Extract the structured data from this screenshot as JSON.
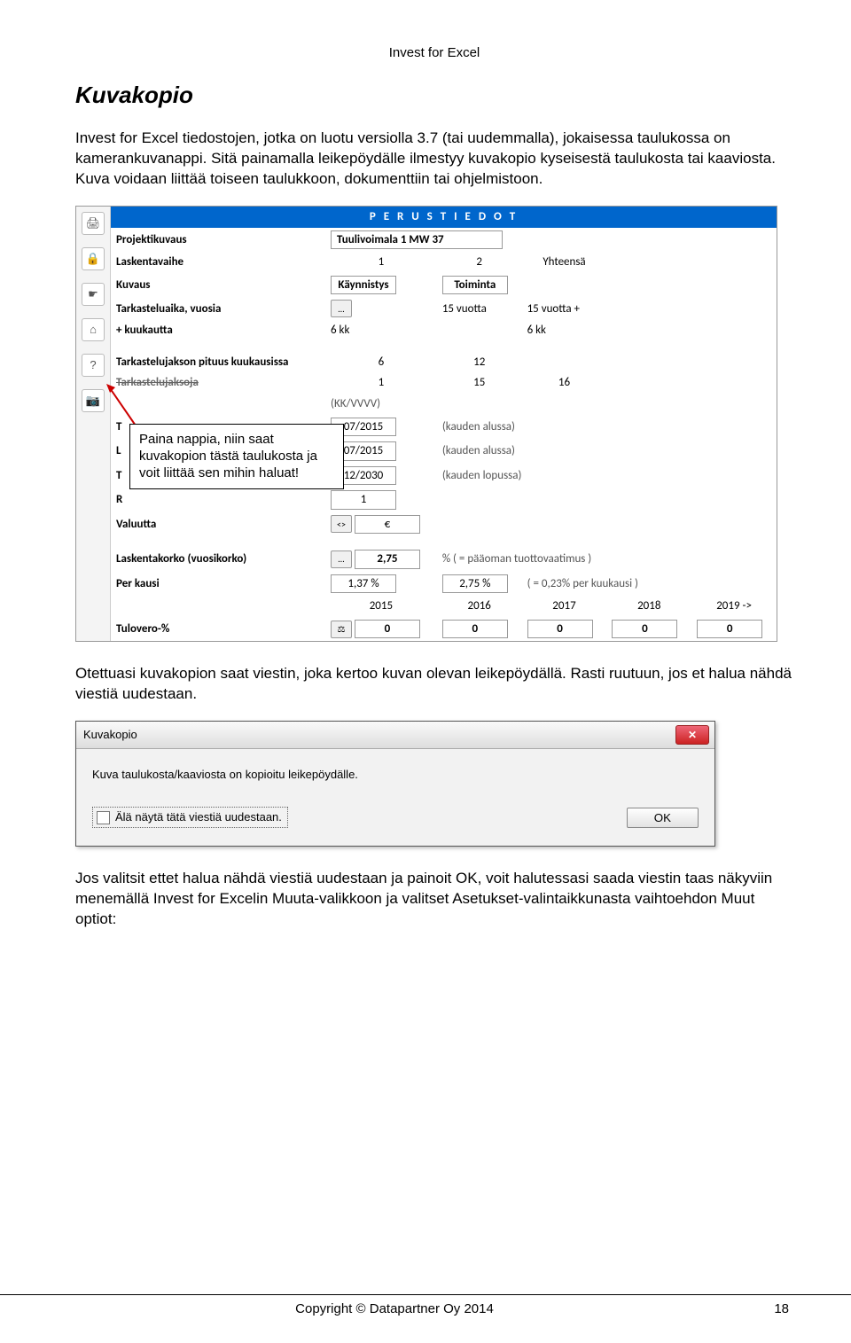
{
  "header_top": "Invest for Excel",
  "section_title": "Kuvakopio",
  "para1": "Invest for Excel tiedostojen, jotka on luotu versiolla 3.7 (tai uudemmalla), jokaisessa taulukossa on kamerankuvanappi. Sitä painamalla leikepöydälle ilmestyy kuvakopio kyseisestä taulukosta tai kaaviosta. Kuva voidaan liittää toiseen taulukkoon, dokumenttiin tai ohjelmistoon.",
  "callout": "Paina nappia, niin saat kuvakopion tästä taulukosta ja voit liittää sen mihin haluat!",
  "para2": "Otettuasi kuvakopion saat viestin, joka kertoo kuvan olevan leikepöydällä. Rasti ruutuun, jos et halua nähdä viestiä uudestaan.",
  "para3": "Jos valitsit ettet halua nähdä viestiä uudestaan ja painoit OK, voit halutessasi saada viestin taas näkyviin menemällä Invest for Excelin Muuta-valikkoon ja valitset Asetukset-valintaikkunasta vaihtoehdon Muut optiot:",
  "footer_center": "Copyright © Datapartner Oy 2014",
  "footer_page": "18",
  "shot1": {
    "title_bar": "P E R U S T I E D O T",
    "rows": {
      "projektikuvaus_label": "Projektikuvaus",
      "projektikuvaus_value": "Tuulivoimala 1 MW 37",
      "laskentavaihe_label": "Laskentavaihe",
      "laskentavaihe_c1": "1",
      "laskentavaihe_c2": "2",
      "laskentavaihe_c3": "Yhteensä",
      "kuvaus_label": "Kuvaus",
      "kuvaus_c1": "Käynnistys",
      "kuvaus_c2": "Toiminta",
      "tarkastelu_label": "Tarkasteluaika, vuosia",
      "tarkastelu_c2": "15 vuotta",
      "tarkastelu_c3": "15 vuotta +",
      "plus_kk_label": "+ kuukautta",
      "plus_kk_c1": "6 kk",
      "plus_kk_c3": "6 kk",
      "pituus_label": "Tarkastelujakson pituus kuukausissa",
      "pituus_c1": "6",
      "pituus_c2": "12",
      "jaksoja_label": "Tarkastelujaksoja",
      "jaksoja_c1": "1",
      "jaksoja_c2": "15",
      "jaksoja_c3": "16",
      "kkvvvv": "(KK/VVVV)",
      "date1": "07/2015",
      "date1_note": "(kauden alussa)",
      "date2": "07/2015",
      "date2_note": "(kauden alussa)",
      "date3": "12/2030",
      "date3_note": "(kauden lopussa)",
      "r_c1": "1",
      "valuutta_label": "Valuutta",
      "valuutta_c1": "€",
      "korko_label": "Laskentakorko (vuosikorko)",
      "korko_c1": "2,75",
      "korko_note": "%  ( = pääoman tuottovaatimus )",
      "perkausi_label": "Per kausi",
      "perkausi_c1": "1,37 %",
      "perkausi_c2": "2,75 %",
      "perkausi_note": "( = 0,23% per kuukausi )",
      "years_h1": "2015",
      "years_h2": "2016",
      "years_h3": "2017",
      "years_h4": "2018",
      "years_h5": "2019 ->",
      "tulovero_label": "Tulovero-%",
      "tulovero_v": "0"
    },
    "hidden_left": {
      "t": "T",
      "l": "L",
      "ta": "T",
      "r": "R"
    }
  },
  "dialog": {
    "title": "Kuvakopio",
    "message": "Kuva taulukosta/kaaviosta on kopioitu leikepöydälle.",
    "checkbox_label": "Älä näytä tätä viestiä uudestaan.",
    "ok": "OK"
  }
}
